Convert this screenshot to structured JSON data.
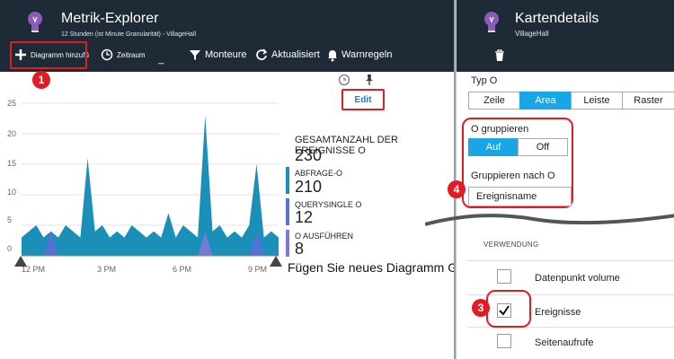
{
  "metrics": {
    "title": "Metrik-Explorer",
    "subtitle": "12 Stunden (ist Minute Granularität) - VillageHall",
    "toolbar": {
      "add_chart": "Diagramm hinzufü",
      "time_range": "Zeitraum",
      "filter": "Monteure",
      "refresh": "Aktualisiert",
      "alerts": "Warnregeln"
    },
    "edit_label": "Edit",
    "y_ticks": [
      "25",
      "20",
      "15",
      "10",
      "5",
      "0"
    ],
    "x_ticks": [
      "12 PM",
      "3 PM",
      "6 PM",
      "9 PM"
    ],
    "legend": {
      "total_label": "GESAMTANZAHL DER EREIGNISSE O",
      "total_value": "230",
      "items": [
        {
          "label": "ABFRAGE-O",
          "value": "210",
          "color": "#1a8fb8"
        },
        {
          "label": "QUERYSINGLE O",
          "value": "12",
          "color": "#5b6fd6"
        },
        {
          "label": "O AUSFÜHREN",
          "value": "8",
          "color": "#7a79d6"
        }
      ]
    },
    "add_note": "Fügen Sie neues Diagramm G)"
  },
  "details": {
    "title": "Kartendetails",
    "subtitle": "VillageHall",
    "type_label": "Typ O",
    "types": [
      "Zeile",
      "Area",
      "Leiste",
      "Raster"
    ],
    "active_type": "Area",
    "group_label": "O gruppieren",
    "group_on": "Auf",
    "group_off": "Off",
    "group_by_label": "Gruppieren nach O",
    "group_by_value": "Ereignisname",
    "usage_label": "VERWENDUNG",
    "usage_items": [
      {
        "label": "Datenpunkt volume",
        "checked": false
      },
      {
        "label": "Ereignisse",
        "checked": true
      },
      {
        "label": "Seitenaufrufe",
        "checked": false
      }
    ]
  },
  "callouts": [
    "1",
    "3",
    "4"
  ],
  "colors": {
    "header_bg": "#1e2a35",
    "accent": "#1aa5e4",
    "callout": "#e31b23",
    "series_main": "#1a8fb8",
    "series_alt": "#6b6fd6"
  },
  "chart_data": {
    "type": "area",
    "x": [
      "12 PM",
      "3 PM",
      "6 PM",
      "9 PM"
    ],
    "ylim": [
      0,
      25
    ],
    "series": [
      {
        "name": "ABFRAGE-O",
        "values": [
          3,
          4,
          5,
          3,
          4,
          3,
          5,
          4,
          3,
          16,
          4,
          5,
          3,
          4,
          3,
          5,
          4,
          3,
          4,
          3,
          7,
          3,
          5,
          4,
          3,
          23,
          4,
          5,
          3,
          4,
          3,
          5,
          15,
          3,
          4,
          3
        ]
      },
      {
        "name": "QUERYSINGLE O",
        "values": [
          0,
          0,
          0,
          0,
          4,
          0,
          0,
          0,
          0,
          0,
          0,
          0,
          0,
          0,
          0,
          0,
          0,
          0,
          0,
          0,
          0,
          0,
          0,
          0,
          0,
          0,
          0,
          0,
          0,
          0,
          0,
          0,
          4,
          0,
          0,
          0
        ]
      },
      {
        "name": "O AUSFÜHREN",
        "values": [
          0,
          0,
          0,
          0,
          0,
          0,
          0,
          0,
          0,
          0,
          0,
          0,
          0,
          0,
          0,
          0,
          0,
          0,
          0,
          0,
          0,
          0,
          0,
          0,
          0,
          4,
          0,
          0,
          0,
          0,
          0,
          0,
          0,
          0,
          0,
          0
        ]
      }
    ]
  }
}
